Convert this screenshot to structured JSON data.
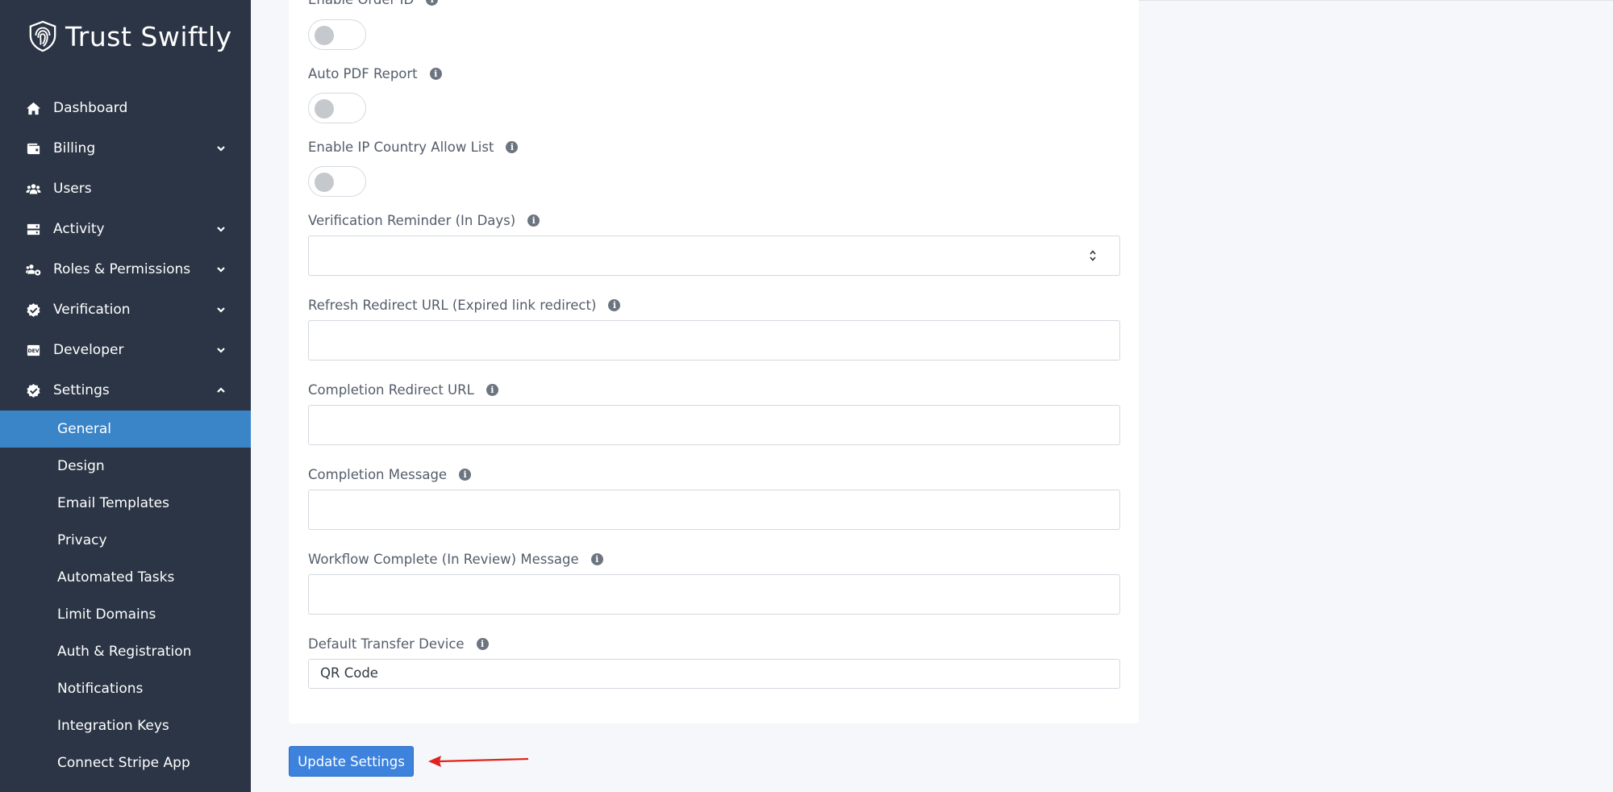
{
  "brand": {
    "name": "Trust Swiftly",
    "logo_icon": "fingerprint-shield-icon"
  },
  "sidebar": {
    "items": [
      {
        "label": "Dashboard",
        "icon": "home-icon",
        "expandable": false
      },
      {
        "label": "Billing",
        "icon": "wallet-icon",
        "expandable": true
      },
      {
        "label": "Users",
        "icon": "users-icon",
        "expandable": false
      },
      {
        "label": "Activity",
        "icon": "server-icon",
        "expandable": true
      },
      {
        "label": "Roles & Permissions",
        "icon": "user-group-gear-icon",
        "expandable": true
      },
      {
        "label": "Verification",
        "icon": "check-badge-icon",
        "expandable": true
      },
      {
        "label": "Developer",
        "icon": "dev-icon",
        "expandable": true
      },
      {
        "label": "Settings",
        "icon": "check-badge-icon",
        "expandable": true,
        "expanded": true
      }
    ],
    "settings_sub": [
      {
        "label": "General",
        "active": true
      },
      {
        "label": "Design"
      },
      {
        "label": "Email Templates"
      },
      {
        "label": "Privacy"
      },
      {
        "label": "Automated Tasks"
      },
      {
        "label": "Limit Domains"
      },
      {
        "label": "Auth & Registration"
      },
      {
        "label": "Notifications"
      },
      {
        "label": "Integration Keys"
      },
      {
        "label": "Connect Stripe App"
      }
    ]
  },
  "form": {
    "enable_order_id": {
      "label": "Enable Order ID",
      "on": false
    },
    "auto_pdf_report": {
      "label": "Auto PDF Report",
      "on": false
    },
    "ip_country_allow_list": {
      "label": "Enable IP Country Allow List",
      "on": false
    },
    "verification_reminder": {
      "label": "Verification Reminder (In Days)",
      "value": ""
    },
    "refresh_redirect_url": {
      "label": "Refresh Redirect URL (Expired link redirect)",
      "value": ""
    },
    "completion_redirect_url": {
      "label": "Completion Redirect URL",
      "value": ""
    },
    "completion_message": {
      "label": "Completion Message",
      "value": ""
    },
    "workflow_complete_message": {
      "label": "Workflow Complete (In Review) Message",
      "value": ""
    },
    "default_transfer_device": {
      "label": "Default Transfer Device",
      "value": "QR Code"
    }
  },
  "actions": {
    "update_label": "Update Settings"
  },
  "colors": {
    "sidebar_bg": "#2b3545",
    "active_item": "#3a84c8",
    "primary_button": "#3d82dc",
    "annotation_arrow": "#e0231c"
  }
}
